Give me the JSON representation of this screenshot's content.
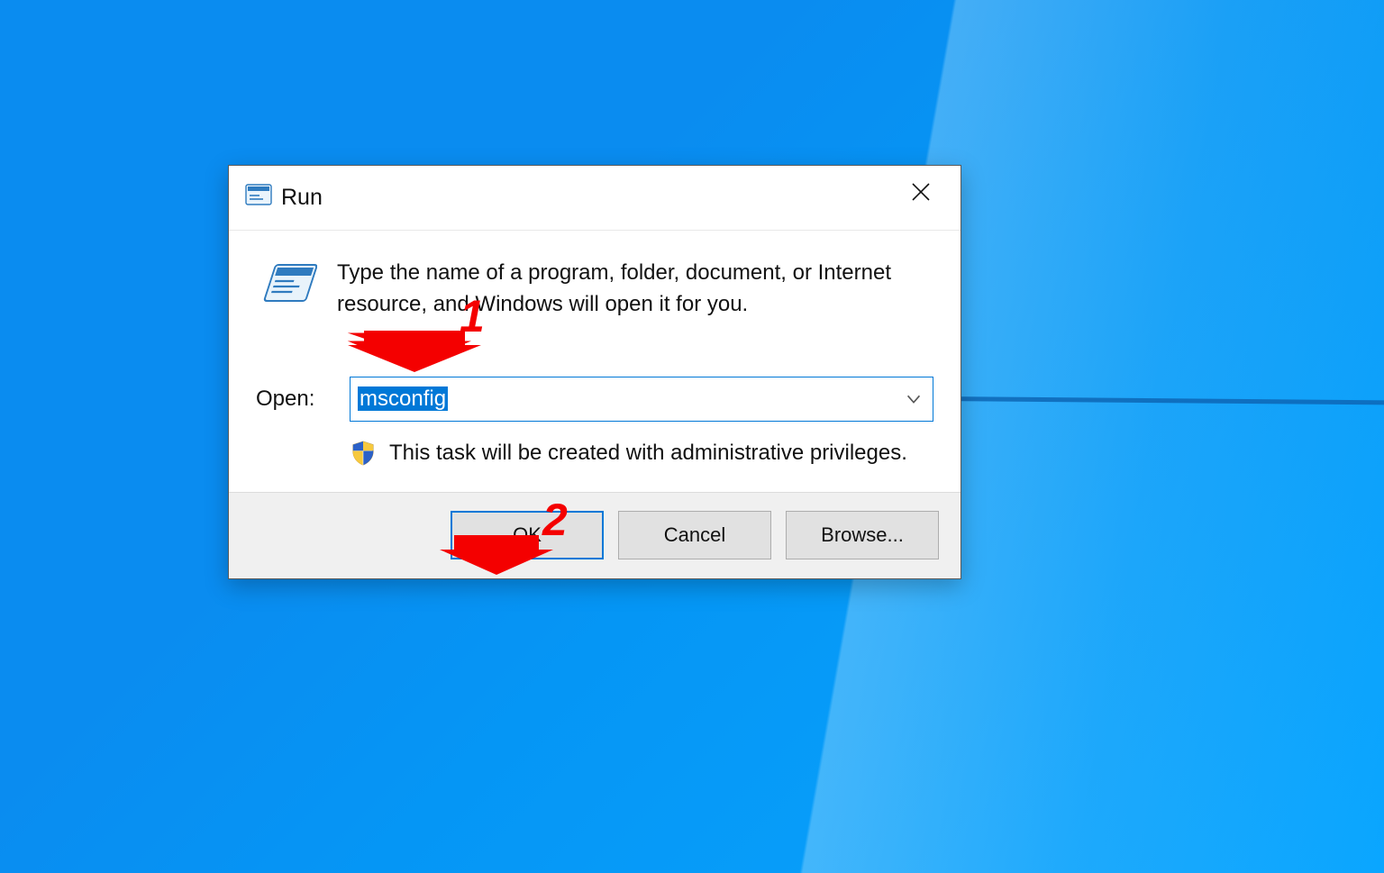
{
  "dialog": {
    "title": "Run",
    "instruction": "Type the name of a program, folder, document, or Internet resource, and Windows will open it for you.",
    "open_label": "Open:",
    "open_value": "msconfig",
    "admin_notice": "This task will be created with administrative privileges.",
    "buttons": {
      "ok": "OK",
      "cancel": "Cancel",
      "browse": "Browse..."
    }
  },
  "annotations": {
    "step1": "1",
    "step2": "2"
  }
}
